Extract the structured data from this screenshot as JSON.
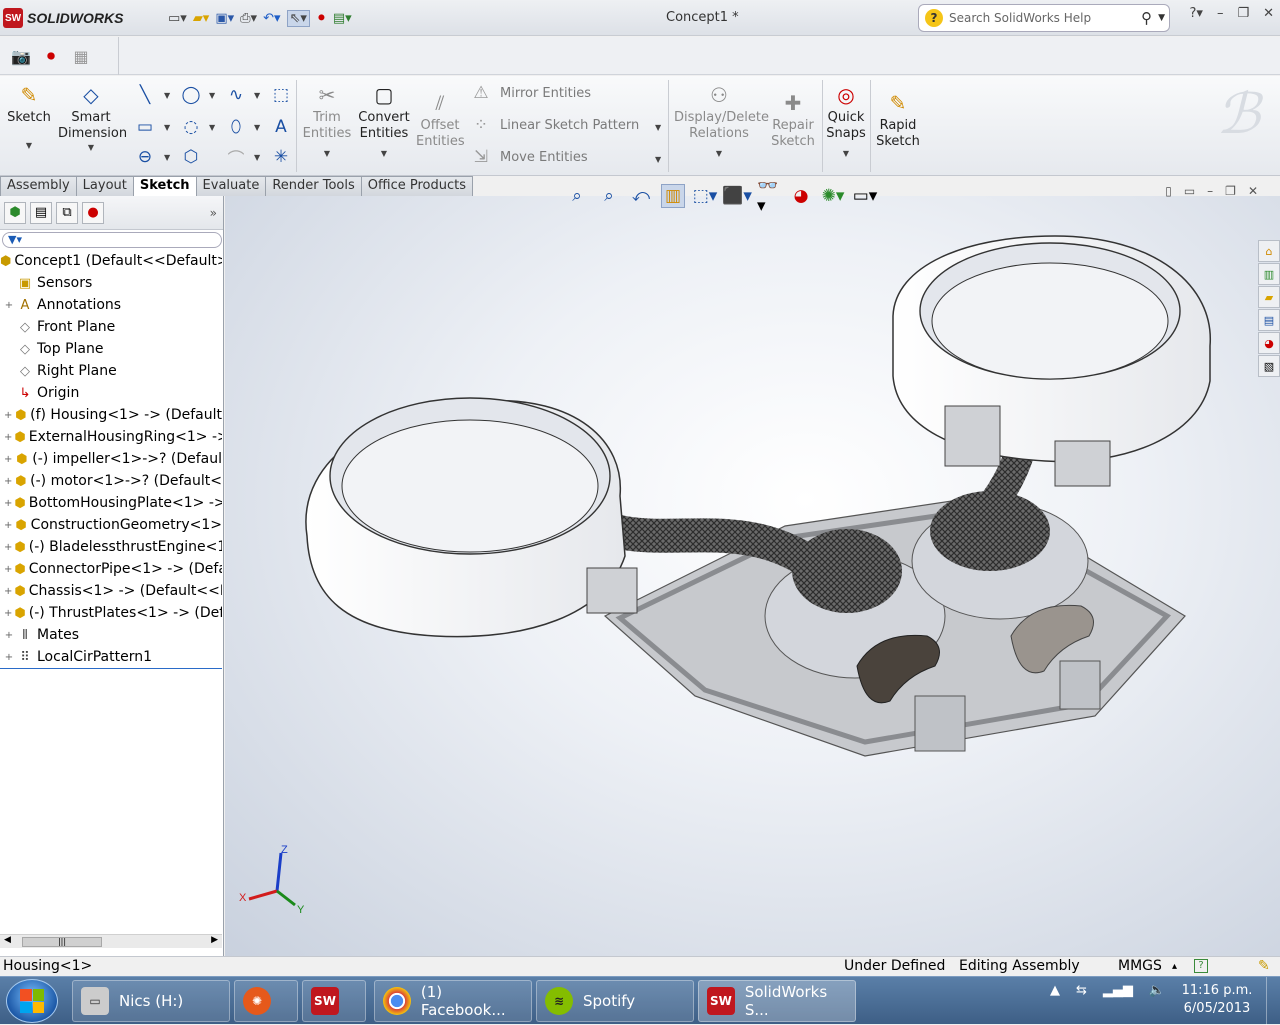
{
  "app": {
    "logo_text": "SOLIDWORKS",
    "logo_letters": "SW",
    "doc_title": "Concept1 *"
  },
  "search": {
    "placeholder": "Search SolidWorks Help"
  },
  "ribbon": {
    "sketch": "Sketch",
    "smart_dimension": [
      "Smart",
      "Dimension"
    ],
    "trim_entities": [
      "Trim",
      "Entities"
    ],
    "convert_entities": [
      "Convert",
      "Entities"
    ],
    "offset_entities": [
      "Offset",
      "Entities"
    ],
    "mirror_entities": "Mirror Entities",
    "linear_sketch_pattern": "Linear Sketch Pattern",
    "move_entities": "Move Entities",
    "display_delete_relations": [
      "Display/Delete",
      "Relations"
    ],
    "repair_sketch": [
      "Repair",
      "Sketch"
    ],
    "quick_snaps": [
      "Quick",
      "Snaps"
    ],
    "rapid_sketch": [
      "Rapid",
      "Sketch"
    ]
  },
  "tabs": [
    {
      "label": "Assembly",
      "active": false
    },
    {
      "label": "Layout",
      "active": false
    },
    {
      "label": "Sketch",
      "active": true
    },
    {
      "label": "Evaluate",
      "active": false
    },
    {
      "label": "Render Tools",
      "active": false
    },
    {
      "label": "Office Products",
      "active": false
    }
  ],
  "tree": [
    {
      "label": "Concept1  (Default<<Default>",
      "icon": "assembly-icon",
      "level": 0,
      "expand": ""
    },
    {
      "label": "Sensors",
      "icon": "sensors-icon",
      "level": 1,
      "expand": ""
    },
    {
      "label": "Annotations",
      "icon": "annotations-icon",
      "level": 1,
      "expand": "+"
    },
    {
      "label": "Front Plane",
      "icon": "plane-icon",
      "level": 1,
      "expand": ""
    },
    {
      "label": "Top Plane",
      "icon": "plane-icon",
      "level": 1,
      "expand": ""
    },
    {
      "label": "Right Plane",
      "icon": "plane-icon",
      "level": 1,
      "expand": ""
    },
    {
      "label": "Origin",
      "icon": "origin-icon",
      "level": 1,
      "expand": ""
    },
    {
      "label": "(f) Housing<1> -> (Default",
      "icon": "part-icon",
      "level": 1,
      "expand": "+"
    },
    {
      "label": "ExternalHousingRing<1> ->",
      "icon": "part-icon",
      "level": 1,
      "expand": "+"
    },
    {
      "label": "(-) impeller<1>->? (Defaul",
      "icon": "part-icon",
      "level": 1,
      "expand": "+"
    },
    {
      "label": "(-) motor<1>->? (Default<",
      "icon": "part-icon",
      "level": 1,
      "expand": "+"
    },
    {
      "label": "BottomHousingPlate<1> ->",
      "icon": "part-icon",
      "level": 1,
      "expand": "+"
    },
    {
      "label": "ConstructionGeometry<1>",
      "icon": "part-icon",
      "level": 1,
      "expand": "+"
    },
    {
      "label": "(-) BladelessthrustEngine<1",
      "icon": "part-icon",
      "level": 1,
      "expand": "+"
    },
    {
      "label": "ConnectorPipe<1> -> (Defa",
      "icon": "part-icon",
      "level": 1,
      "expand": "+"
    },
    {
      "label": "Chassis<1> -> (Default<<D",
      "icon": "part-icon",
      "level": 1,
      "expand": "+"
    },
    {
      "label": "(-) ThrustPlates<1> -> (Def",
      "icon": "part-icon",
      "level": 1,
      "expand": "+"
    },
    {
      "label": "Mates",
      "icon": "mates-icon",
      "level": 1,
      "expand": "+"
    },
    {
      "label": "LocalCirPattern1",
      "icon": "pattern-icon",
      "level": 1,
      "expand": "+"
    }
  ],
  "status": {
    "left": "Housing<1>",
    "state": "Under Defined",
    "mode": "Editing Assembly",
    "units": "MMGS",
    "units_arrow": "▴",
    "help": "?"
  },
  "axes": {
    "x": "X",
    "y": "Y",
    "z": "Z"
  },
  "taskbar": {
    "items": [
      {
        "label": "Nics (H:)",
        "icon": "drive-icon"
      },
      {
        "label": "",
        "icon": "reason-icon"
      },
      {
        "label": "",
        "icon": "solidworks-icon",
        "letters": "SW"
      },
      {
        "label": "(1) Facebook...",
        "icon": "chrome-icon"
      },
      {
        "label": "Spotify",
        "icon": "spotify-icon"
      },
      {
        "label": "SolidWorks S...",
        "icon": "solidworks-icon",
        "letters": "SW"
      }
    ],
    "time": "11:16 p.m.",
    "date": "6/05/2013"
  }
}
